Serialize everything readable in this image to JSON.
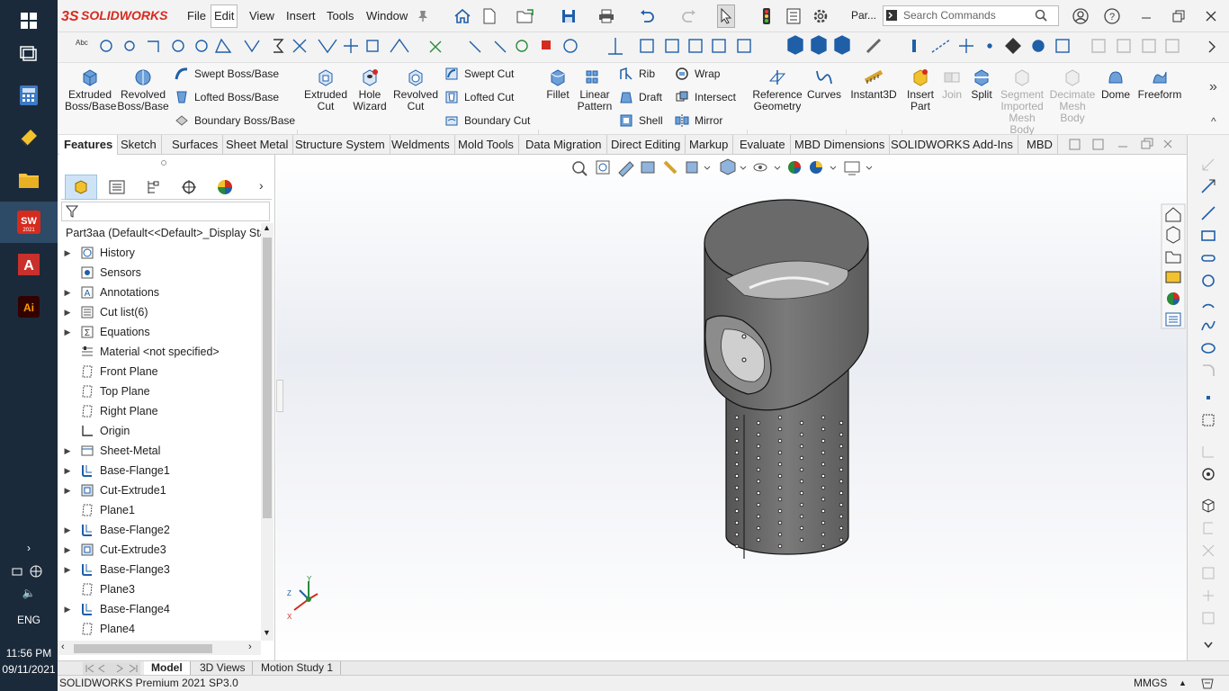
{
  "taskbar": {
    "apps": [
      {
        "name": "windows-start",
        "label": "Start"
      },
      {
        "name": "task-view",
        "label": "Task View"
      },
      {
        "name": "calculator",
        "label": "Calculator"
      },
      {
        "name": "app-4",
        "label": ""
      },
      {
        "name": "file-explorer",
        "label": "File Explorer"
      },
      {
        "name": "solidworks",
        "label": "SW 2021"
      },
      {
        "name": "autocad",
        "label": "A"
      },
      {
        "name": "illustrator",
        "label": "Ai"
      }
    ],
    "tray": {
      "language": "ENG",
      "time": "11:56 PM",
      "date": "09/11/2021"
    }
  },
  "titlebar": {
    "logo_text": "SOLIDWORKS",
    "menus": [
      "File",
      "Edit",
      "View",
      "Insert",
      "Tools",
      "Window"
    ],
    "active_menu": "Edit",
    "doc_name": "Par...",
    "search_placeholder": "Search Commands"
  },
  "ribbon": {
    "big_buttons": [
      {
        "label": "Extruded Boss/Base"
      },
      {
        "label": "Revolved Boss/Base"
      },
      {
        "label": "Extruded Cut"
      },
      {
        "label": "Hole Wizard"
      },
      {
        "label": "Revolved Cut"
      },
      {
        "label": "Fillet"
      },
      {
        "label": "Linear Pattern"
      },
      {
        "label": "Reference Geometry"
      },
      {
        "label": "Curves"
      },
      {
        "label": "Instant3D"
      },
      {
        "label": "Insert Part"
      },
      {
        "label": "Join"
      },
      {
        "label": "Split"
      },
      {
        "label": "Segment Imported Mesh Body"
      },
      {
        "label": "Decimate Mesh Body"
      },
      {
        "label": "Dome"
      },
      {
        "label": "Freeform"
      }
    ],
    "small_buttons": [
      {
        "label": "Swept Boss/Base"
      },
      {
        "label": "Lofted Boss/Base"
      },
      {
        "label": "Boundary Boss/Base"
      },
      {
        "label": "Swept Cut"
      },
      {
        "label": "Lofted Cut"
      },
      {
        "label": "Boundary Cut"
      },
      {
        "label": "Rib"
      },
      {
        "label": "Draft"
      },
      {
        "label": "Shell"
      },
      {
        "label": "Wrap"
      },
      {
        "label": "Intersect"
      },
      {
        "label": "Mirror"
      }
    ]
  },
  "command_tabs": [
    "Features",
    "Sketch",
    "Surfaces",
    "Sheet Metal",
    "Structure System",
    "Weldments",
    "Mold Tools",
    "Data Migration",
    "Direct Editing",
    "Markup",
    "Evaluate",
    "MBD Dimensions",
    "SOLIDWORKS Add-Ins",
    "MBD"
  ],
  "active_tab": "Features",
  "feature_tree": {
    "root": "Part3aa  (Default<<Default>_Display State",
    "items": [
      {
        "label": "History",
        "icon": "history-icon",
        "expandable": true
      },
      {
        "label": "Sensors",
        "icon": "sensors-icon",
        "expandable": false
      },
      {
        "label": "Annotations",
        "icon": "annotations-icon",
        "expandable": true
      },
      {
        "label": "Cut list(6)",
        "icon": "cut-list-icon",
        "expandable": true
      },
      {
        "label": "Equations",
        "icon": "equations-icon",
        "expandable": true
      },
      {
        "label": "Material <not specified>",
        "icon": "material-icon",
        "expandable": false
      },
      {
        "label": "Front Plane",
        "icon": "plane-icon",
        "expandable": false
      },
      {
        "label": "Top Plane",
        "icon": "plane-icon",
        "expandable": false
      },
      {
        "label": "Right Plane",
        "icon": "plane-icon",
        "expandable": false
      },
      {
        "label": "Origin",
        "icon": "origin-icon",
        "expandable": false
      },
      {
        "label": "Sheet-Metal",
        "icon": "sheet-metal-icon",
        "expandable": true
      },
      {
        "label": "Base-Flange1",
        "icon": "base-flange-icon",
        "expandable": true
      },
      {
        "label": "Cut-Extrude1",
        "icon": "cut-extrude-icon",
        "expandable": true
      },
      {
        "label": "Plane1",
        "icon": "plane-icon",
        "expandable": false
      },
      {
        "label": "Base-Flange2",
        "icon": "base-flange-icon",
        "expandable": true
      },
      {
        "label": "Cut-Extrude3",
        "icon": "cut-extrude-icon",
        "expandable": true
      },
      {
        "label": "Base-Flange3",
        "icon": "base-flange-icon",
        "expandable": true
      },
      {
        "label": "Plane3",
        "icon": "plane-icon",
        "expandable": false
      },
      {
        "label": "Base-Flange4",
        "icon": "base-flange-icon",
        "expandable": true
      },
      {
        "label": "Plane4",
        "icon": "plane-icon",
        "expandable": false
      }
    ]
  },
  "triad": {
    "x": "X",
    "y": "Y",
    "z": "Z"
  },
  "bottom_tabs": [
    "Model",
    "3D Views",
    "Motion Study 1"
  ],
  "active_bottom_tab": "Model",
  "status": {
    "product": "SOLIDWORKS Premium 2021 SP3.0",
    "units": "MMGS"
  },
  "colors": {
    "accent": "#d52b1e",
    "taskbar": "#1b2a3a",
    "part": "#6e6e6e",
    "tab_active": "#ffffff"
  }
}
